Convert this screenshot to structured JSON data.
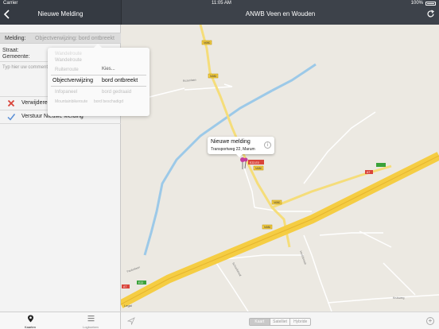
{
  "status_bar": {
    "carrier": "Carrier",
    "time": "11:05 AM",
    "battery": "100%"
  },
  "left_nav": {
    "title": "Nieuwe Melding"
  },
  "right_nav": {
    "title": "ANWB Veen en Wouden"
  },
  "form": {
    "melding_label": "Melding:",
    "melding_value": "Objectverwijzing: bord ontbreekt",
    "straat_label": "Straat:",
    "gemeente_label": "Gemeente:",
    "textarea_placeholder": "Typ hier uw commentaar"
  },
  "actions": {
    "delete_label": "Verwijderen",
    "send_label": "Verstuur Nieuwe Melding"
  },
  "dropdown": {
    "options": [
      {
        "left": "Wandelroute",
        "right": ""
      },
      {
        "left": "Wandelroute",
        "right": ""
      },
      {
        "left": "Ruiterroute",
        "right": "Kies..."
      },
      {
        "left": "Objectverwijzing",
        "right": "bord ontbreekt"
      },
      {
        "left": "Infopaneel",
        "right": "bord gedraaid"
      },
      {
        "left": "Mountainbikeroute",
        "right": "bord beschadigd"
      }
    ]
  },
  "map": {
    "callout_title": "Nieuwe melding",
    "callout_subtitle": "Transportweg 22, Marum",
    "legal": "Legal",
    "road_labels": [
      "N980",
      "N980",
      "N980",
      "N980",
      "E22-E0",
      "N980",
      "A7",
      "A7",
      "E22"
    ],
    "street_labels": [
      "Rozenlaan",
      "Pauluslaan",
      "Hoofdstraat",
      "Schoolstraat",
      "Kruisweg"
    ],
    "map_type_options": [
      "Kaart",
      "Satelliet",
      "Hybride"
    ],
    "active_map_type": "Kaart"
  },
  "tabs": [
    {
      "label": "Kaarten",
      "active": true
    },
    {
      "label": "Logboeken",
      "active": false
    }
  ],
  "colors": {
    "nav_bg": "#353a42",
    "highway": "#f5cd43",
    "water": "#9cc9e8",
    "delete_red": "#d9443a",
    "check_blue": "#5a8fd6",
    "pin": "#c43d9c"
  }
}
